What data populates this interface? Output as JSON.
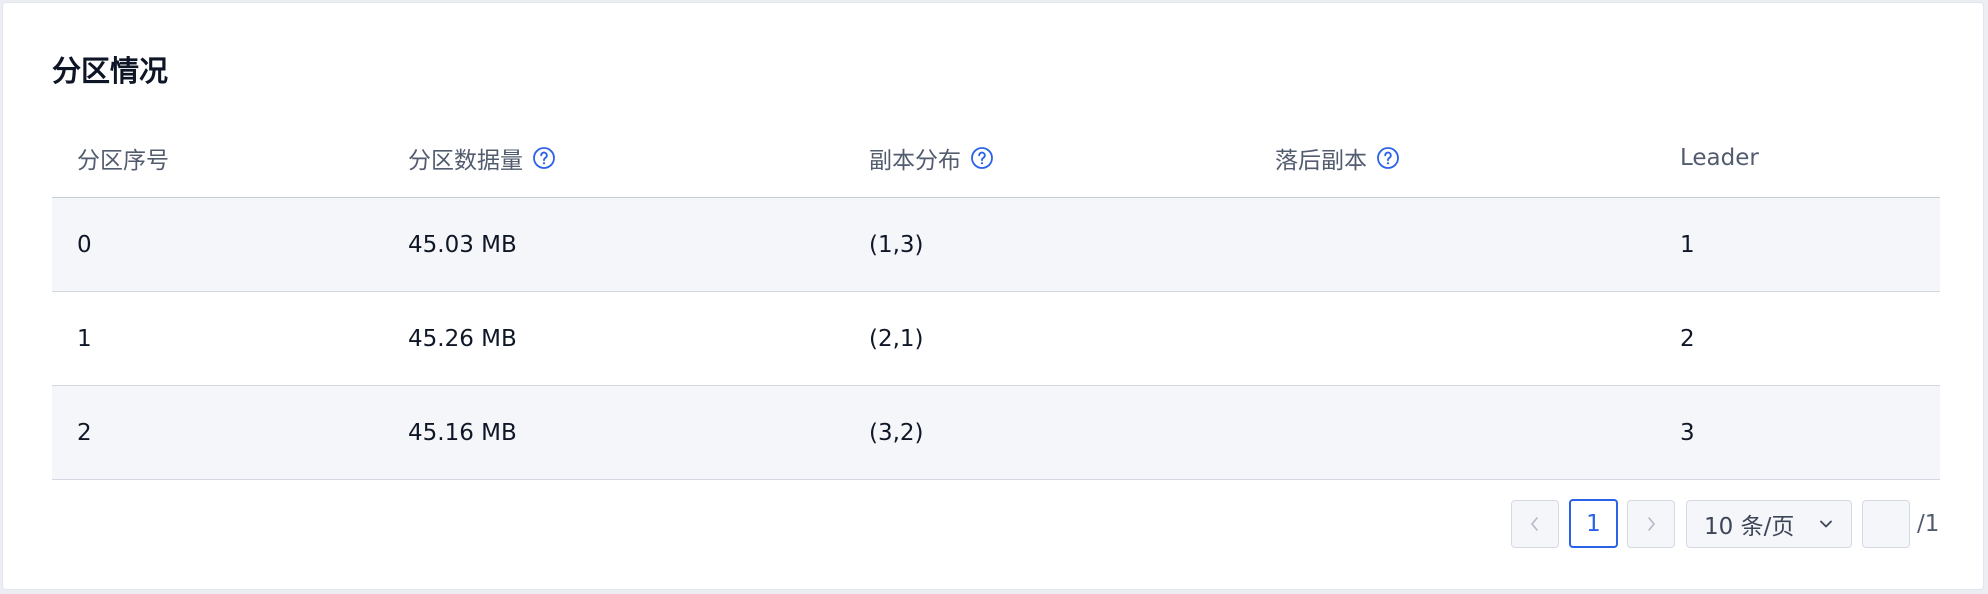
{
  "section": {
    "title": "分区情况"
  },
  "table": {
    "columns": [
      {
        "label": "分区序号",
        "help_icon": false
      },
      {
        "label": "分区数据量",
        "help_icon": true
      },
      {
        "label": "副本分布",
        "help_icon": true
      },
      {
        "label": "落后副本",
        "help_icon": true
      },
      {
        "label": "Leader",
        "help_icon": false
      }
    ],
    "rows": [
      [
        "0",
        "45.03 MB",
        "(1,3)",
        "",
        "1"
      ],
      [
        "1",
        "45.26 MB",
        "(2,1)",
        "",
        "2"
      ],
      [
        "2",
        "45.16 MB",
        "(3,2)",
        "",
        "3"
      ]
    ]
  },
  "pagination": {
    "prev_icon": "chevron-left-icon",
    "next_icon": "chevron-right-icon",
    "current_page": "1",
    "page_size_label": "10 条/页",
    "page_size_icon": "chevron-down-icon",
    "jump_value": "",
    "total_pages": "/1"
  },
  "colors": {
    "accent": "#2a62e8",
    "row_stripe": "#f5f6fa",
    "text": "#0f1726",
    "muted_text": "#525c6e"
  }
}
